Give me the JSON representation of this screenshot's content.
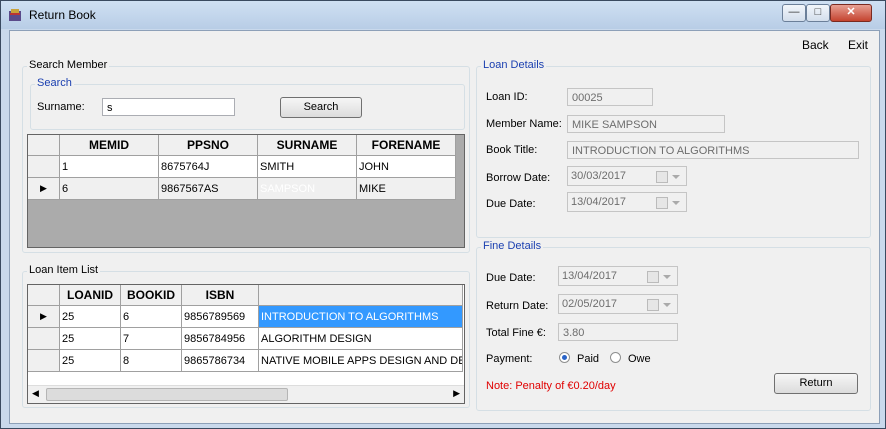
{
  "window": {
    "title": "Return Book",
    "minimize": "—",
    "maximize": "□",
    "close": "✕"
  },
  "menu": {
    "back": "Back",
    "exit": "Exit"
  },
  "search_member": {
    "group_title": "Search Member",
    "search_group_title": "Search",
    "surname_label": "Surname:",
    "surname_value": "s",
    "search_button": "Search",
    "columns": [
      "MEMID",
      "PPSNO",
      "SURNAME",
      "FORENAME"
    ],
    "rows": [
      [
        "1",
        "8675764J",
        "SMITH",
        "JOHN"
      ],
      [
        "6",
        "9867567AS",
        "SAMPSON",
        "MIKE"
      ]
    ]
  },
  "loan_items": {
    "group_title": "Loan Item List",
    "columns": [
      "LOANID",
      "BOOKID",
      "ISBN",
      ""
    ],
    "rows": [
      [
        "25",
        "6",
        "9856789569",
        "INTRODUCTION TO ALGORITHMS"
      ],
      [
        "25",
        "7",
        "9856784956",
        "ALGORITHM DESIGN"
      ],
      [
        "25",
        "8",
        "9865786734",
        "NATIVE MOBILE APPS DESIGN AND DEVELOPMENT"
      ]
    ]
  },
  "loan_details": {
    "group_title": "Loan Details",
    "loan_id_label": "Loan ID:",
    "loan_id": "00025",
    "member_name_label": "Member Name:",
    "member_name": "MIKE SAMPSON",
    "book_title_label": "Book Title:",
    "book_title": "INTRODUCTION TO ALGORITHMS",
    "borrow_date_label": "Borrow Date:",
    "borrow_date": "30/03/2017",
    "due_date_label": "Due Date:",
    "due_date": "13/04/2017"
  },
  "fine_details": {
    "group_title": "Fine Details",
    "due_date_label": "Due Date:",
    "due_date": "13/04/2017",
    "return_date_label": "Return Date:",
    "return_date": "02/05/2017",
    "total_fine_label": "Total Fine €:",
    "total_fine": "3.80",
    "payment_label": "Payment:",
    "paid_label": "Paid",
    "owe_label": "Owe",
    "payment_selected": "Paid",
    "note": "Note: Penalty of €0.20/day",
    "return_button": "Return"
  },
  "colors": {
    "selection": "#3399ff",
    "note": "#e00000",
    "group_title": "#1a3fb0"
  }
}
